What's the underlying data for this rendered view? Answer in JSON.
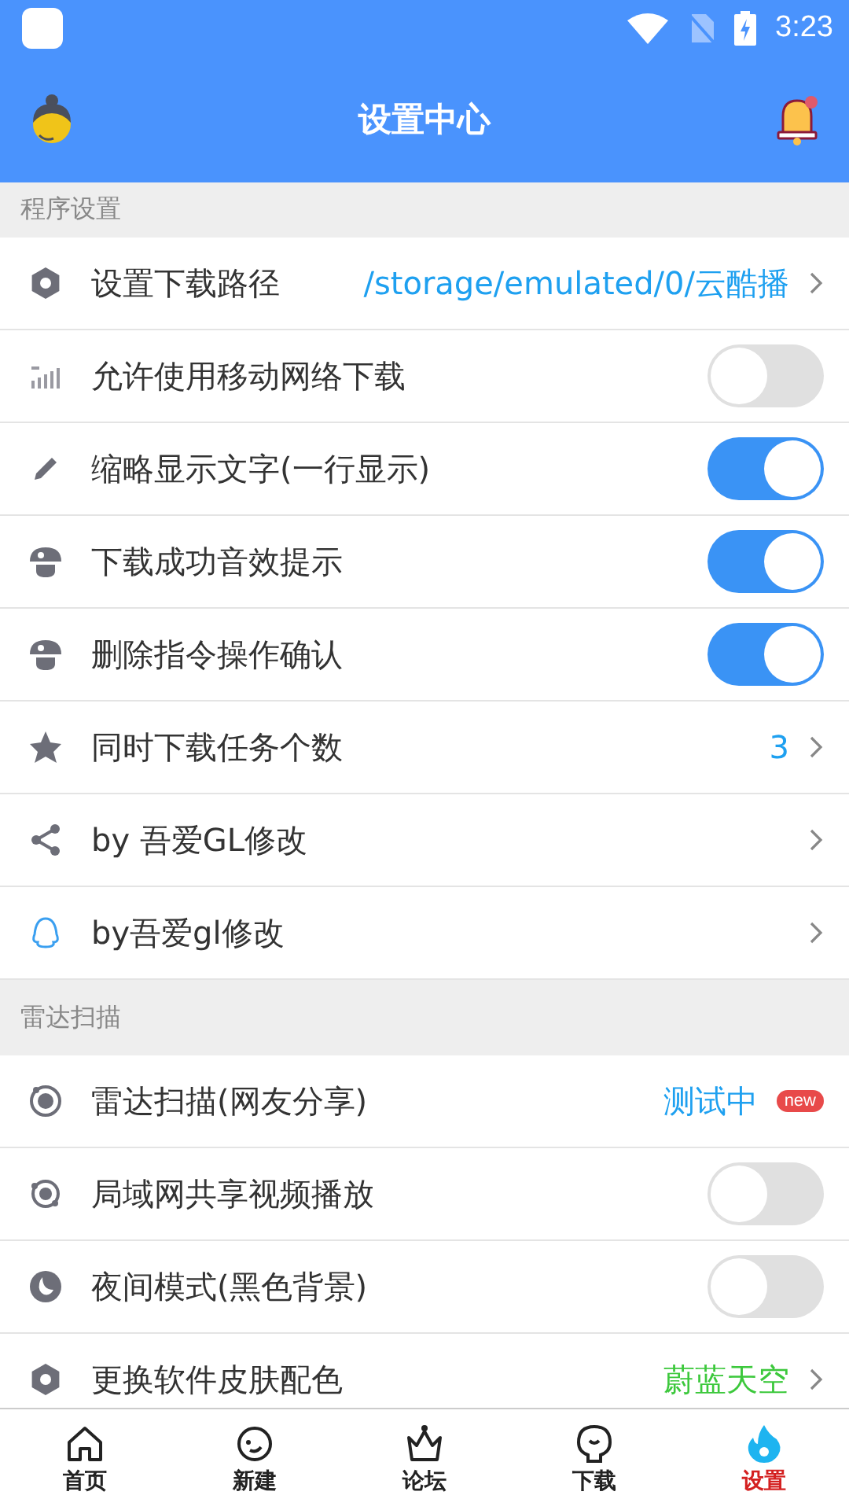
{
  "status_bar": {
    "time": "3:23"
  },
  "app_bar": {
    "title": "设置中心"
  },
  "sections": [
    {
      "title": "程序设置",
      "rows": [
        {
          "kind": "link",
          "label": "设置下载路径",
          "value": "/storage/emulated/0/云酷播",
          "color": "#1ea0f0"
        },
        {
          "kind": "toggle",
          "label": "允许使用移动网络下载",
          "on": false
        },
        {
          "kind": "toggle",
          "label": "缩略显示文字(一行显示)",
          "on": true
        },
        {
          "kind": "toggle",
          "label": "下载成功音效提示",
          "on": true
        },
        {
          "kind": "toggle",
          "label": "删除指令操作确认",
          "on": true
        },
        {
          "kind": "link",
          "label": "同时下载任务个数",
          "value": "3",
          "color": "#1ea0f0"
        },
        {
          "kind": "link",
          "label": "by 吾爱GL修改"
        },
        {
          "kind": "link",
          "label": "by吾爱gl修改"
        }
      ]
    },
    {
      "title": "雷达扫描",
      "rows": [
        {
          "kind": "badge",
          "label": "雷达扫描(网友分享)",
          "value": "测试中",
          "color": "#1ea0f0",
          "badge": "new"
        },
        {
          "kind": "toggle",
          "label": "局域网共享视频播放",
          "on": false
        },
        {
          "kind": "toggle",
          "label": "夜间模式(黑色背景)",
          "on": false
        },
        {
          "kind": "link",
          "label": "更换软件皮肤配色",
          "value": "蔚蓝天空",
          "color": "#3cc83c"
        }
      ]
    }
  ],
  "bottom_nav": [
    {
      "label": "首页",
      "selected": false
    },
    {
      "label": "新建",
      "selected": false
    },
    {
      "label": "论坛",
      "selected": false
    },
    {
      "label": "下载",
      "selected": false
    },
    {
      "label": "设置",
      "selected": true
    }
  ]
}
